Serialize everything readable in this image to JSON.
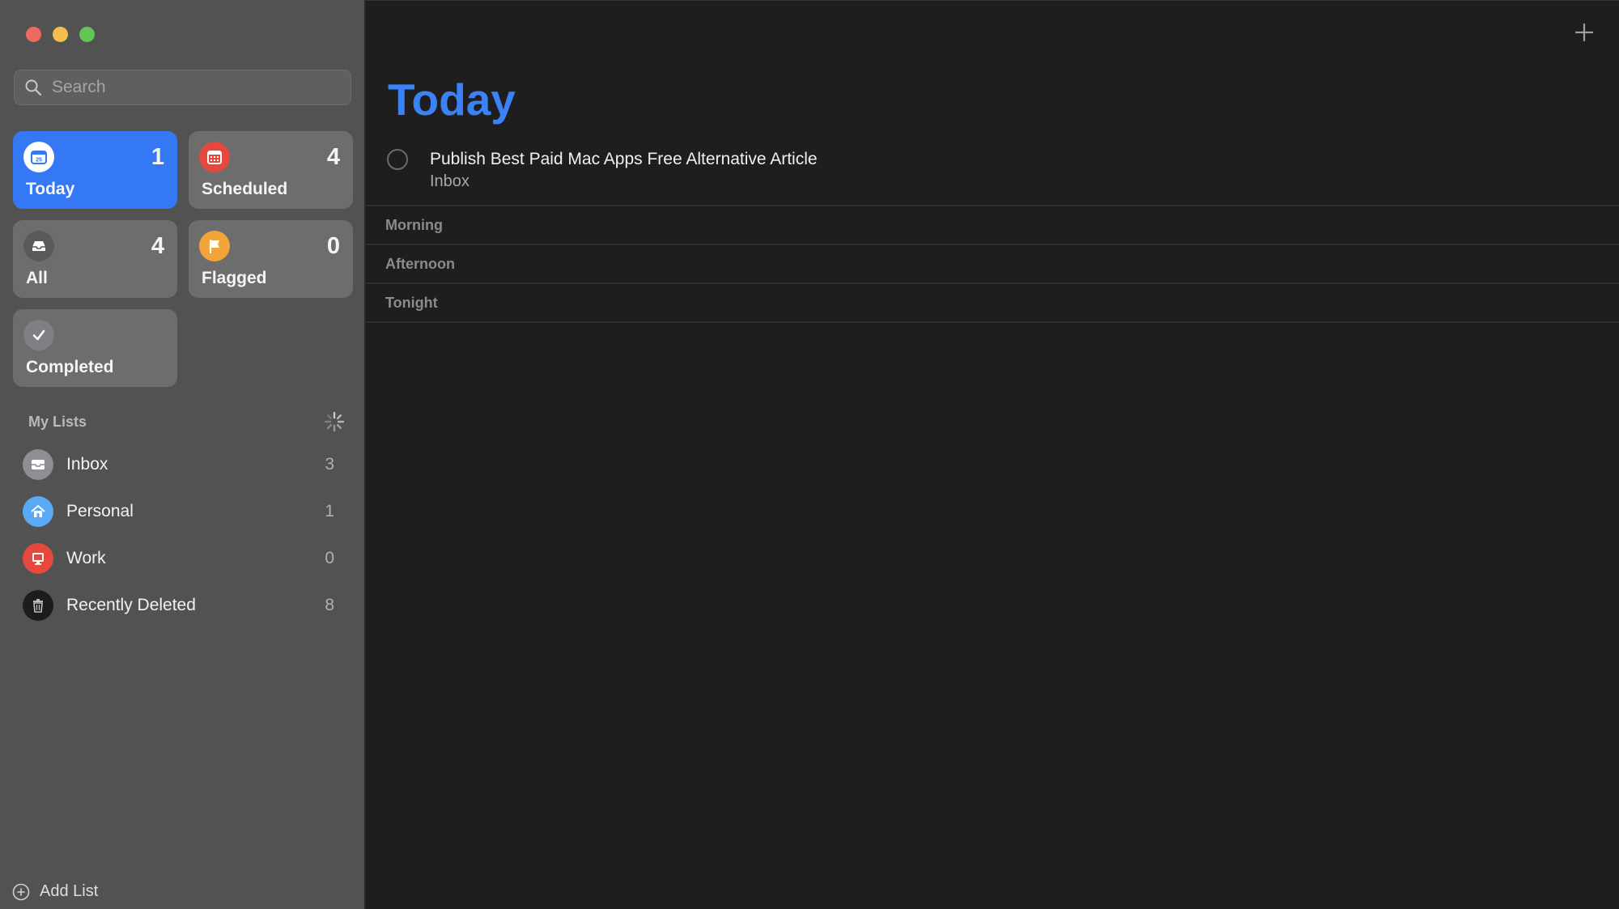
{
  "window": {
    "controls": [
      "close",
      "minimize",
      "zoom"
    ]
  },
  "sidebar": {
    "search": {
      "placeholder": "Search"
    },
    "smart_lists": [
      {
        "label": "Today",
        "count": "1",
        "icon": "calendar-icon",
        "color": "#3478f6",
        "active": true
      },
      {
        "label": "Scheduled",
        "count": "4",
        "icon": "calendar-grid-icon",
        "color": "#e5483d"
      },
      {
        "label": "All",
        "count": "4",
        "icon": "tray-icon",
        "color": "#5a5a5b"
      },
      {
        "label": "Flagged",
        "count": "0",
        "icon": "flag-icon",
        "color": "#f2a33a"
      },
      {
        "label": "Completed",
        "count": "",
        "icon": "checkmark-icon",
        "color": "#7f7f84"
      }
    ],
    "my_lists_title": "My Lists",
    "lists": [
      {
        "name": "Inbox",
        "count": "3",
        "icon": "inbox-icon",
        "color": "#8e8e93"
      },
      {
        "name": "Personal",
        "count": "1",
        "icon": "house-icon",
        "color": "#5aa9f4"
      },
      {
        "name": "Work",
        "count": "0",
        "icon": "monitor-icon",
        "color": "#e5483d"
      },
      {
        "name": "Recently Deleted",
        "count": "8",
        "icon": "trash-icon",
        "color": "#1c1c1c"
      }
    ],
    "add_list_label": "Add List"
  },
  "main": {
    "title": "Today",
    "accent": "#3b82f6",
    "task": {
      "title": "Publish Best Paid Mac Apps Free Alternative Article",
      "list": "Inbox"
    },
    "sections": [
      "Morning",
      "Afternoon",
      "Tonight"
    ]
  }
}
